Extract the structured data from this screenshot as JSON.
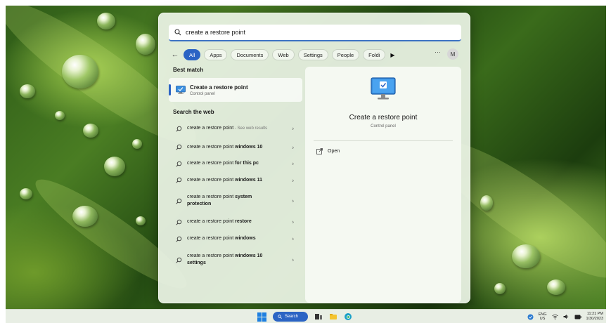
{
  "search": {
    "query": "create a restore point"
  },
  "filters": {
    "back": "←",
    "tabs": [
      "All",
      "Apps",
      "Documents",
      "Web",
      "Settings",
      "People",
      "Foldi"
    ],
    "more": "···",
    "avatar_initial": "M"
  },
  "best_match": {
    "section": "Best match",
    "title": "Create a restore point",
    "subtitle": "Control panel"
  },
  "web": {
    "section": "Search the web",
    "items": [
      {
        "plain": "create a restore point",
        "bold": "",
        "hint": " - See web results"
      },
      {
        "plain": "create a restore point ",
        "bold": "windows 10",
        "hint": ""
      },
      {
        "plain": "create a restore point ",
        "bold": "for this pc",
        "hint": ""
      },
      {
        "plain": "create a restore point ",
        "bold": "windows 11",
        "hint": ""
      },
      {
        "plain": "create a restore point ",
        "bold": "system protection",
        "hint": ""
      },
      {
        "plain": "create a restore point ",
        "bold": "restore",
        "hint": ""
      },
      {
        "plain": "create a restore point ",
        "bold": "windows",
        "hint": ""
      },
      {
        "plain": "create a restore point ",
        "bold": "windows 10 settings",
        "hint": ""
      }
    ]
  },
  "preview": {
    "title": "Create a restore point",
    "subtitle": "Control panel",
    "open_label": "Open"
  },
  "taskbar": {
    "search_label": "Search",
    "lang_top": "ENG",
    "lang_bottom": "US",
    "time": "11:21 PM",
    "date": "1/30/2023"
  },
  "colors": {
    "accent": "#2b64c4",
    "panel": "#ecf4e6"
  }
}
